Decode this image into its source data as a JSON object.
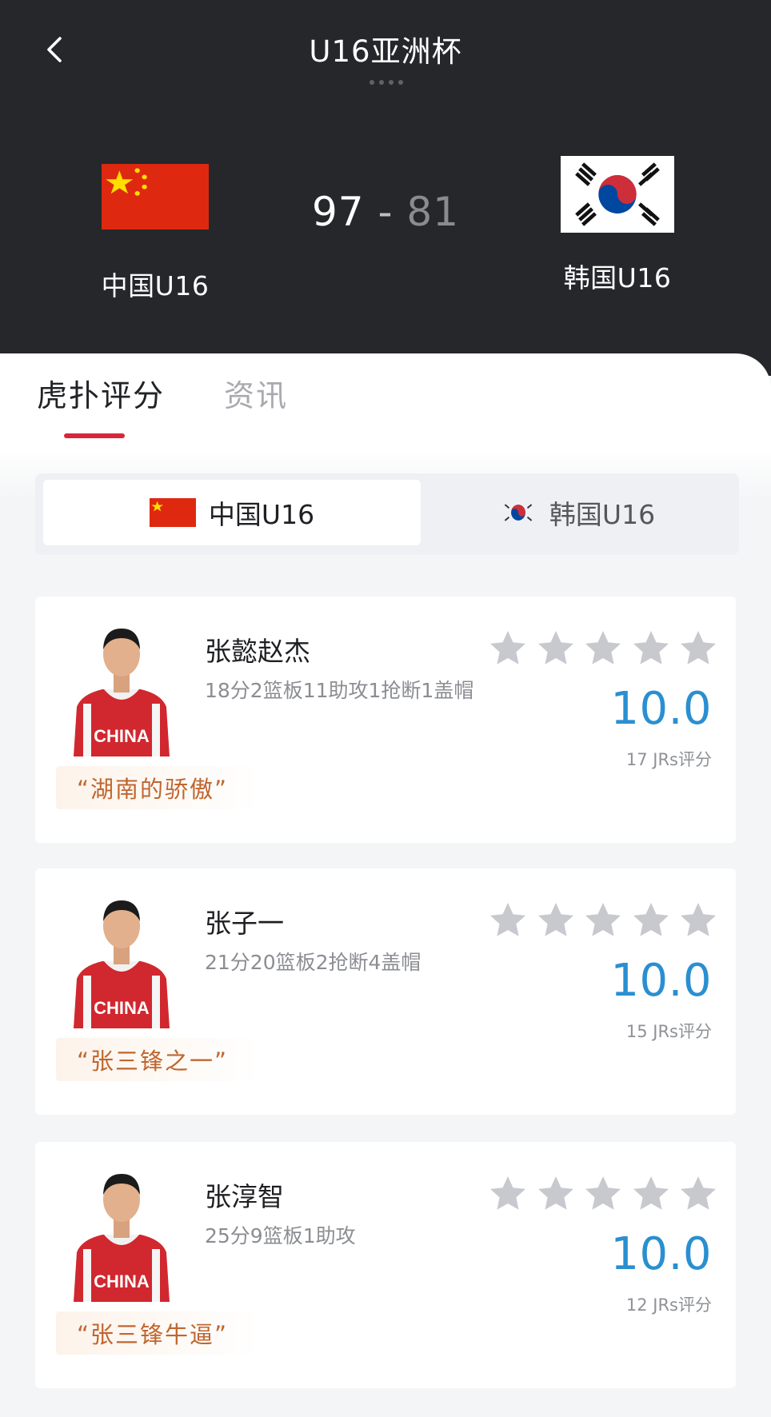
{
  "header": {
    "title": "U16亚洲杯",
    "home_team": {
      "name": "中国U16",
      "flag": "china-flag"
    },
    "away_team": {
      "name": "韩国U16",
      "flag": "korea-flag"
    },
    "home_score": "97",
    "separator": " - ",
    "away_score": "81"
  },
  "tabs": [
    {
      "label": "虎扑评分",
      "active": true
    },
    {
      "label": "资讯",
      "active": false
    }
  ],
  "team_switch": [
    {
      "label": "中国U16",
      "active": true,
      "flag": "china-flag"
    },
    {
      "label": "韩国U16",
      "active": false,
      "flag": "korea-flag"
    }
  ],
  "players": [
    {
      "name": "张懿赵杰",
      "stats": "18分2篮板11助攻1抢断1盖帽",
      "rating": "10.0",
      "rating_count": "17 JRs评分",
      "quote": "“湖南的骄傲”",
      "stars_filled": 0,
      "jersey": "CHINA"
    },
    {
      "name": "张子一",
      "stats": "21分20篮板2抢断4盖帽",
      "rating": "10.0",
      "rating_count": "15 JRs评分",
      "quote": "“张三锋之一”",
      "stars_filled": 0,
      "jersey": "CHINA"
    },
    {
      "name": "张淳智",
      "stats": "25分9篮板1助攻",
      "rating": "10.0",
      "rating_count": "12 JRs评分",
      "quote": "“张三锋牛逼”",
      "stars_filled": 0,
      "jersey": "CHINA"
    }
  ],
  "colors": {
    "header_bg": "#26272b",
    "accent_red": "#d7263b",
    "rating_blue": "#2a8fd0",
    "star_gray": "#c8c9ce",
    "quote_orange": "#c0662f"
  },
  "icons": {
    "back": "chevron-left-icon",
    "star": "star-icon"
  }
}
